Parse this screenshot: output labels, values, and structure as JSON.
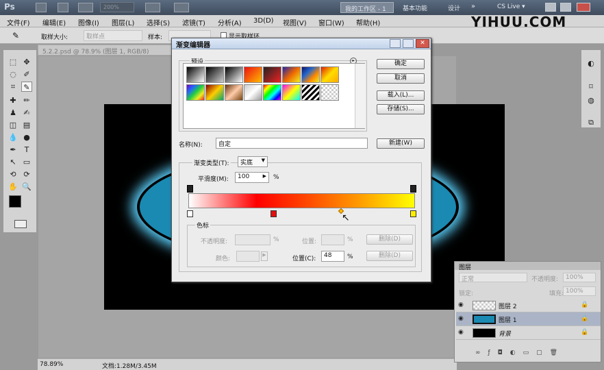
{
  "app": {
    "logo": "Ps",
    "zoom": "200%",
    "workspaces": [
      "我的工作区 - 1",
      "基本功能",
      "设计"
    ],
    "cs_live": "CS Live ▾",
    "brand": "YIHUU.COM"
  },
  "menu": [
    "文件(F)",
    "编辑(E)",
    "图像(I)",
    "图层(L)",
    "选择(S)",
    "滤镜(T)",
    "分析(A)",
    "3D(D)",
    "视图(V)",
    "窗口(W)",
    "帮助(H)"
  ],
  "options": {
    "sample_size_label": "取样大小:",
    "sample_size_value": "取样点",
    "sample_label": "样本:",
    "show_ring_label": "显示取样环"
  },
  "document": {
    "tab_title": "5.2.2.psd @ 78.9% (图层 1, RGB/8)"
  },
  "status": {
    "zoom": "78.89%",
    "doc_size": "文档:1.28M/3.45M"
  },
  "dialog": {
    "title": "渐变编辑器",
    "presets_label": "预设",
    "buttons": {
      "ok": "确定",
      "cancel": "取消",
      "load": "载入(L)...",
      "save": "存储(S)...",
      "new": "新建(W)"
    },
    "name_label": "名称(N):",
    "name_value": "自定",
    "type_label": "渐变类型(T):",
    "type_value": "实底",
    "smooth_label": "平滑度(M):",
    "smooth_value": "100",
    "smooth_unit": "%",
    "stops_group_label": "色标",
    "opacity_label": "不透明度:",
    "opacity_unit": "%",
    "position_label": "位置:",
    "position_unit": "%",
    "delete_label": "删除(D)",
    "color_label": "颜色:",
    "color_position_label": "位置(C):",
    "color_position_value": "48",
    "color_position_unit": "%",
    "gradient_colors": [
      "#ffffff",
      "#ff0000",
      "#ff4000",
      "#ff9900",
      "#ffff00"
    ]
  },
  "layers": {
    "panel_title": "图层",
    "blend_mode": "正常",
    "opacity_label": "不透明度:",
    "opacity_value": "100%",
    "lock_label": "锁定:",
    "fill_label": "填充:",
    "fill_value": "100%",
    "items": [
      {
        "name": "图层 2"
      },
      {
        "name": "图层 1"
      },
      {
        "name": "背景"
      }
    ]
  }
}
